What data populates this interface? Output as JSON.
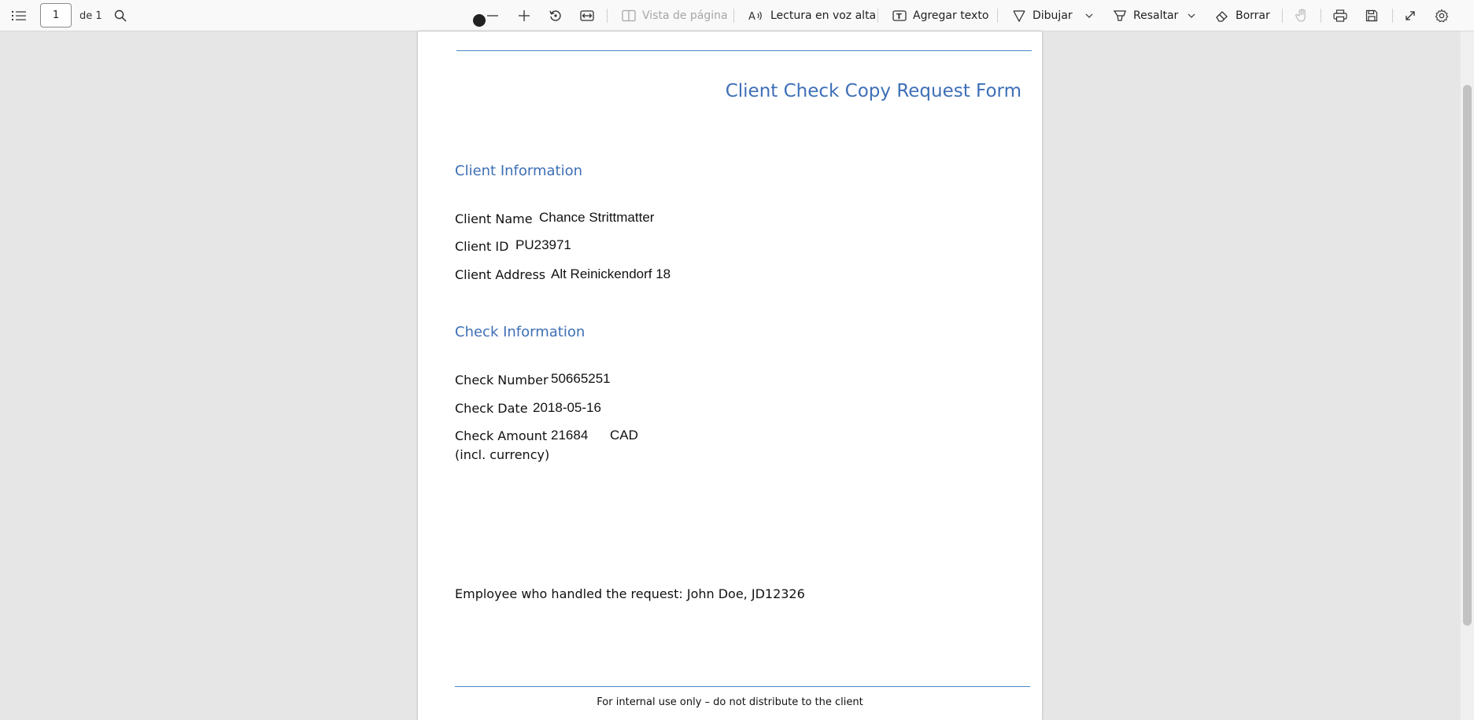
{
  "toolbar": {
    "page_current": "1",
    "page_total": "de 1",
    "icons": {
      "contents": "list-icon",
      "search": "search-icon",
      "zoom_out": "minus-icon",
      "zoom_in": "plus-icon",
      "rotate": "rotate-icon",
      "fit": "fit-width-icon",
      "touch": "hand-icon",
      "print": "printer-icon",
      "save": "save-icon",
      "fullscreen": "expand-icon",
      "settings": "gear-icon"
    },
    "page_view_label": "Vista de página",
    "read_aloud_label": "Lectura en voz alta",
    "add_text_label": "Agregar texto",
    "draw_label": "Dibujar",
    "highlight_label": "Resaltar",
    "erase_label": "Borrar"
  },
  "document": {
    "title": "Client Check Copy Request Form",
    "client_section": {
      "heading": "Client Information",
      "name_label": "Client Name",
      "name_value": "Chance Strittmatter",
      "id_label": "Client ID",
      "id_value": "PU23971",
      "address_label": "Client Address",
      "address_value": "Alt Reinickendorf 18"
    },
    "check_section": {
      "heading": "Check Information",
      "number_label": "Check Number",
      "number_value": "50665251",
      "date_label": "Check Date",
      "date_value": "2018-05-16",
      "amount_label": "Check Amount",
      "amount_label_2": "(incl. currency)",
      "amount_value": "21684",
      "currency_value": "CAD"
    },
    "employee_line": "Employee who handled the request: John Doe, JD12326",
    "footer": "For internal use only – do not distribute to the client"
  },
  "colors": {
    "accent_heading": "#3e6fb6",
    "rule": "#4a86c8",
    "viewer_bg": "#e6e6e6",
    "toolbar_bg": "#f9f9f9"
  }
}
